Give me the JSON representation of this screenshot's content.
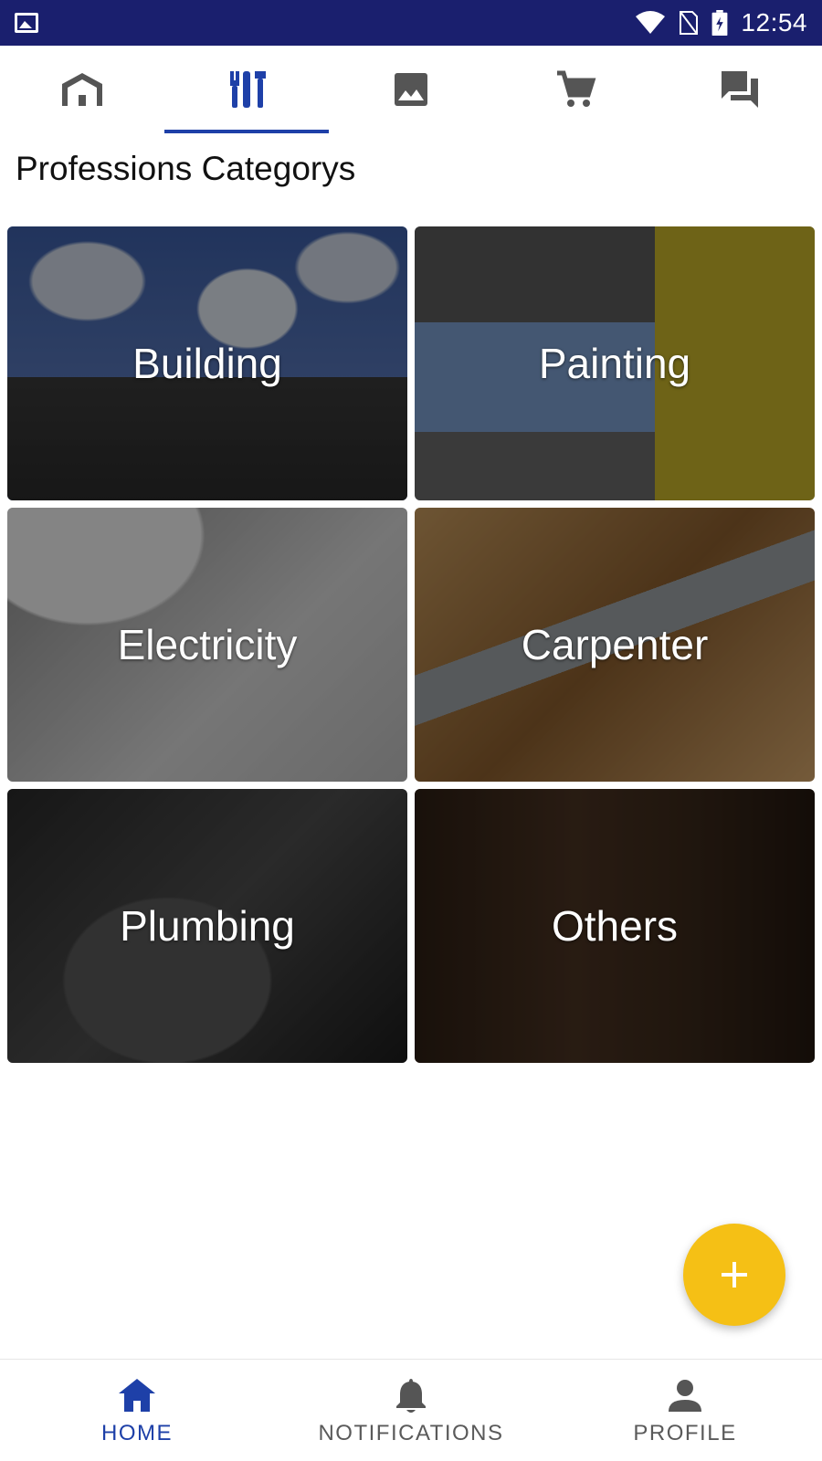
{
  "status_bar": {
    "time": "12:54",
    "icons": [
      "image-notification-icon",
      "wifi-icon",
      "no-sim-icon",
      "battery-charging-icon"
    ]
  },
  "top_tabs": [
    {
      "icon": "home-icon",
      "active": false
    },
    {
      "icon": "tools-icon",
      "active": true
    },
    {
      "icon": "gallery-icon",
      "active": false
    },
    {
      "icon": "cart-icon",
      "active": false
    },
    {
      "icon": "chat-icon",
      "active": false
    }
  ],
  "page": {
    "title": "Professions Categorys"
  },
  "categories": [
    {
      "label": "Building"
    },
    {
      "label": "Painting"
    },
    {
      "label": "Electricity"
    },
    {
      "label": "Carpenter"
    },
    {
      "label": "Plumbing"
    },
    {
      "label": "Others"
    }
  ],
  "fab": {
    "icon": "plus-icon"
  },
  "bottom_nav": [
    {
      "label": "HOME",
      "icon": "home-icon",
      "active": true
    },
    {
      "label": "NOTIFICATIONS",
      "icon": "bell-icon",
      "active": false
    },
    {
      "label": "PROFILE",
      "icon": "person-icon",
      "active": false
    }
  ],
  "colors": {
    "status_bar": "#1a1f6e",
    "accent": "#1e40a8",
    "fab": "#f5c015",
    "inactive_icon": "#555555"
  }
}
